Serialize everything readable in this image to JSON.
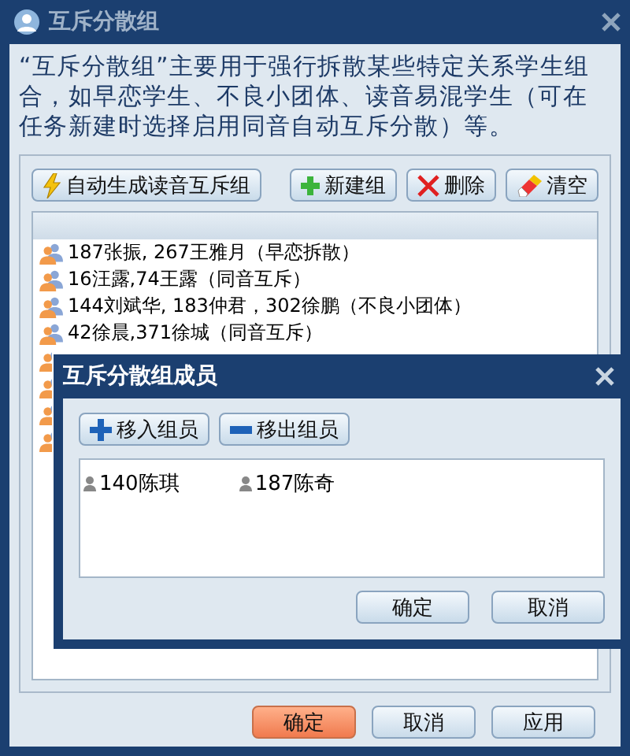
{
  "window": {
    "title": "互斥分散组"
  },
  "description": "“互斥分散组”主要用于强行拆散某些特定关系学生组合，如早恋学生、不良小团体、读音易混学生（可在任务新建时选择启用同音自动互斥分散）等。",
  "toolbar": [
    {
      "kind": "bolt",
      "label": "自动生成读音互斥组"
    },
    {
      "kind": "add",
      "label": "新建组"
    },
    {
      "kind": "delete",
      "label": "删除"
    },
    {
      "kind": "eraser",
      "label": "清空"
    }
  ],
  "groups": [
    {
      "kind": "row",
      "label": "187张振, 267王雅月（早恋拆散）"
    },
    {
      "kind": "row",
      "label": "16汪露,74王露（同音互斥）"
    },
    {
      "kind": "row",
      "label": "144刘斌华, 183仲君，302徐鹏（不良小团体）"
    },
    {
      "kind": "row",
      "label": "42徐晨,371徐城（同音互斥）"
    },
    {
      "kind": "covered"
    },
    {
      "kind": "covered"
    },
    {
      "kind": "covered"
    },
    {
      "kind": "covered"
    }
  ],
  "footer_buttons": [
    {
      "label": "确定",
      "primary": true
    },
    {
      "label": "取消",
      "primary": false
    },
    {
      "label": "应用",
      "primary": false
    }
  ],
  "member_dialog": {
    "title": "互斥分散组成员",
    "toolbar": [
      {
        "kind": "plus",
        "label": "移入组员"
      },
      {
        "kind": "minus",
        "label": "移出组员"
      }
    ],
    "members": [
      "140陈琪",
      "187陈奇"
    ],
    "buttons": [
      "确定",
      "取消"
    ]
  }
}
